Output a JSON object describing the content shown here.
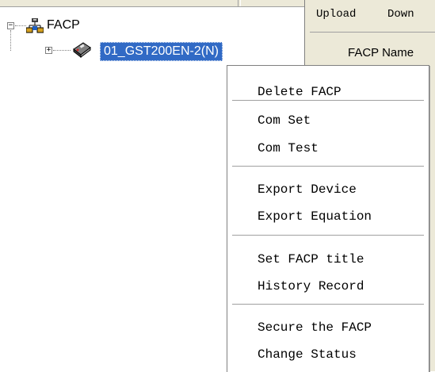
{
  "tree": {
    "root_label": "FACP",
    "root_expander": "−",
    "child_label": "01_GST200EN-2(N)",
    "child_expander": "+"
  },
  "tabs": {
    "upload": "Upload",
    "download": "Down"
  },
  "right_panel": {
    "facp_name_label": "FACP Name"
  },
  "context_menu": {
    "groups": [
      [
        "Delete FACP"
      ],
      [
        "Com Set",
        "Com Test"
      ],
      [
        "Export Device",
        "Export Equation"
      ],
      [
        "Set FACP title",
        "History Record"
      ],
      [
        "Secure the FACP",
        "Change Status"
      ]
    ]
  },
  "colors": {
    "selection": "#316ac5",
    "menu_background": "#ffffff",
    "chrome": "#ece9d8"
  },
  "icons": {
    "root": "network-panel-icon",
    "child": "fire-panel-device-icon"
  }
}
